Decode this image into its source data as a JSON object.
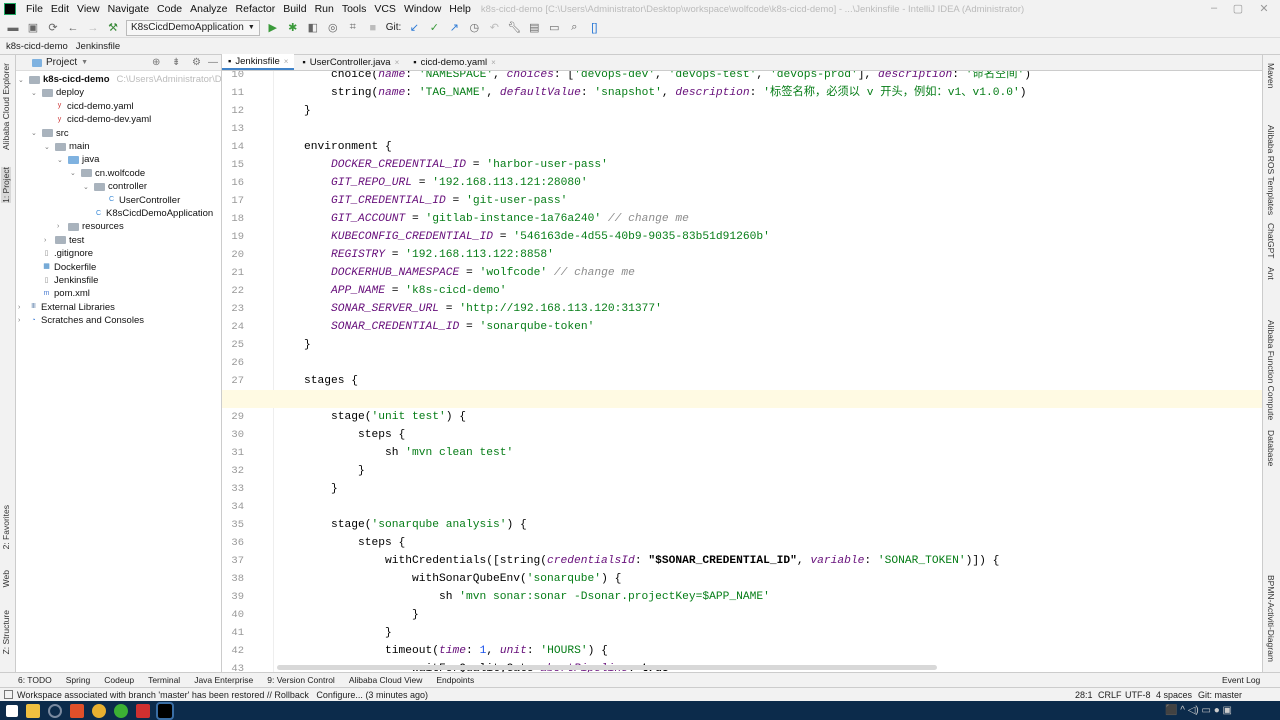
{
  "window": {
    "title": "k8s-cicd-demo [C:\\Users\\Administrator\\Desktop\\workspace\\wolfcode\\k8s-cicd-demo] - ...\\Jenkinsfile - IntelliJ IDEA (Administrator)"
  },
  "menu": [
    "File",
    "Edit",
    "View",
    "Navigate",
    "Code",
    "Analyze",
    "Refactor",
    "Build",
    "Run",
    "Tools",
    "VCS",
    "Window",
    "Help"
  ],
  "toolbar": {
    "run_config": "K8sCicdDemoApplication",
    "git_label": "Git:"
  },
  "navbar": {
    "crumbs": [
      "k8s-cicd-demo",
      "Jenkinsfile"
    ]
  },
  "left_strip": [
    "Alibaba Cloud Explorer",
    "1: Project",
    "2: Favorites",
    "Web",
    "Z: Structure"
  ],
  "right_strip": [
    "Maven",
    "Alibaba ROS Templates",
    "ChatGPT",
    "Ant",
    "Alibaba Function Compute",
    "Database",
    "BPMN-Activiti-Diagram"
  ],
  "project": {
    "header": "Project",
    "tree": [
      {
        "label": "k8s-cicd-demo",
        "hint": "C:\\Users\\Administrator\\Deskto",
        "depth": 0,
        "arrow": "v",
        "icon": "folder",
        "bold": true
      },
      {
        "label": "deploy",
        "depth": 1,
        "arrow": "v",
        "icon": "folder"
      },
      {
        "label": "cicd-demo.yaml",
        "depth": 2,
        "arrow": "",
        "icon": "yaml"
      },
      {
        "label": "cicd-demo-dev.yaml",
        "depth": 2,
        "arrow": "",
        "icon": "yaml"
      },
      {
        "label": "src",
        "depth": 1,
        "arrow": "v",
        "icon": "folder"
      },
      {
        "label": "main",
        "depth": 2,
        "arrow": "v",
        "icon": "folder"
      },
      {
        "label": "java",
        "depth": 3,
        "arrow": "v",
        "icon": "folder-blue"
      },
      {
        "label": "cn.wolfcode",
        "depth": 4,
        "arrow": "v",
        "icon": "folder"
      },
      {
        "label": "controller",
        "depth": 5,
        "arrow": "v",
        "icon": "folder"
      },
      {
        "label": "UserController",
        "depth": 6,
        "arrow": "",
        "icon": "class"
      },
      {
        "label": "K8sCicdDemoApplication",
        "depth": 5,
        "arrow": "",
        "icon": "class"
      },
      {
        "label": "resources",
        "depth": 3,
        "arrow": ">",
        "icon": "folder"
      },
      {
        "label": "test",
        "depth": 2,
        "arrow": ">",
        "icon": "folder"
      },
      {
        "label": ".gitignore",
        "depth": 1,
        "arrow": "",
        "icon": "file"
      },
      {
        "label": "Dockerfile",
        "depth": 1,
        "arrow": "",
        "icon": "docker"
      },
      {
        "label": "Jenkinsfile",
        "depth": 1,
        "arrow": "",
        "icon": "file"
      },
      {
        "label": "pom.xml",
        "depth": 1,
        "arrow": "",
        "icon": "maven"
      },
      {
        "label": "External Libraries",
        "depth": 0,
        "arrow": ">",
        "icon": "lib"
      },
      {
        "label": "Scratches and Consoles",
        "depth": 0,
        "arrow": ">",
        "icon": "scratch"
      }
    ]
  },
  "tabs": [
    {
      "label": "Jenkinsfile",
      "active": true
    },
    {
      "label": "UserController.java"
    },
    {
      "label": "cicd-demo.yaml"
    }
  ],
  "editor": {
    "current_line": 28,
    "first_line": 10,
    "lines": [
      [
        [
          "p",
          "        choice("
        ],
        [
          "k",
          "name"
        ],
        [
          "p",
          ": "
        ],
        [
          "s",
          "'NAMESPACE'"
        ],
        [
          "p",
          ", "
        ],
        [
          "k",
          "choices"
        ],
        [
          "p",
          ": ["
        ],
        [
          "s",
          "'devops-dev'"
        ],
        [
          "p",
          ", "
        ],
        [
          "s",
          "'devops-test'"
        ],
        [
          "p",
          ", "
        ],
        [
          "s",
          "'devops-prod'"
        ],
        [
          "p",
          "], "
        ],
        [
          "k",
          "description"
        ],
        [
          "p",
          ": "
        ],
        [
          "s",
          "'命名空间'"
        ],
        [
          "p",
          ")"
        ]
      ],
      [
        [
          "p",
          "        string("
        ],
        [
          "k",
          "name"
        ],
        [
          "p",
          ": "
        ],
        [
          "s",
          "'TAG_NAME'"
        ],
        [
          "p",
          ", "
        ],
        [
          "k",
          "defaultValue"
        ],
        [
          "p",
          ": "
        ],
        [
          "s",
          "'snapshot'"
        ],
        [
          "p",
          ", "
        ],
        [
          "k",
          "description"
        ],
        [
          "p",
          ": "
        ],
        [
          "s",
          "'标签名称，必须以 v 开头，例如：v1、v1.0.0'"
        ],
        [
          "p",
          ")"
        ]
      ],
      [
        [
          "p",
          "    }"
        ]
      ],
      [],
      [
        [
          "p",
          "    environment {"
        ]
      ],
      [
        [
          "p",
          "        "
        ],
        [
          "k",
          "DOCKER_CREDENTIAL_ID"
        ],
        [
          "p",
          " = "
        ],
        [
          "s",
          "'harbor-user-pass'"
        ]
      ],
      [
        [
          "p",
          "        "
        ],
        [
          "k",
          "GIT_REPO_URL"
        ],
        [
          "p",
          " = "
        ],
        [
          "s",
          "'192.168.113.121:28080'"
        ]
      ],
      [
        [
          "p",
          "        "
        ],
        [
          "k",
          "GIT_CREDENTIAL_ID"
        ],
        [
          "p",
          " = "
        ],
        [
          "s",
          "'git-user-pass'"
        ]
      ],
      [
        [
          "p",
          "        "
        ],
        [
          "k",
          "GIT_ACCOUNT"
        ],
        [
          "p",
          " = "
        ],
        [
          "s",
          "'gitlab-instance-1a76a240'"
        ],
        [
          "p",
          " "
        ],
        [
          "c",
          "// change me"
        ]
      ],
      [
        [
          "p",
          "        "
        ],
        [
          "k",
          "KUBECONFIG_CREDENTIAL_ID"
        ],
        [
          "p",
          " = "
        ],
        [
          "s",
          "'546163de-4d55-40b9-9035-83b51d91260b'"
        ]
      ],
      [
        [
          "p",
          "        "
        ],
        [
          "k",
          "REGISTRY"
        ],
        [
          "p",
          " = "
        ],
        [
          "s",
          "'192.168.113.122:8858'"
        ]
      ],
      [
        [
          "p",
          "        "
        ],
        [
          "k",
          "DOCKERHUB_NAMESPACE"
        ],
        [
          "p",
          " = "
        ],
        [
          "s",
          "'wolfcode'"
        ],
        [
          "p",
          " "
        ],
        [
          "c",
          "// change me"
        ]
      ],
      [
        [
          "p",
          "        "
        ],
        [
          "k",
          "APP_NAME"
        ],
        [
          "p",
          " = "
        ],
        [
          "s",
          "'k8s-cicd-demo'"
        ]
      ],
      [
        [
          "p",
          "        "
        ],
        [
          "k",
          "SONAR_SERVER_URL"
        ],
        [
          "p",
          " = "
        ],
        [
          "s",
          "'http://192.168.113.120:31377'"
        ]
      ],
      [
        [
          "p",
          "        "
        ],
        [
          "k",
          "SONAR_CREDENTIAL_ID"
        ],
        [
          "p",
          " = "
        ],
        [
          "s",
          "'sonarqube-token'"
        ]
      ],
      [
        [
          "p",
          "    }"
        ]
      ],
      [],
      [
        [
          "p",
          "    stages {"
        ]
      ],
      [],
      [
        [
          "p",
          "        stage("
        ],
        [
          "s",
          "'unit test'"
        ],
        [
          "p",
          ") {"
        ]
      ],
      [
        [
          "p",
          "            steps {"
        ]
      ],
      [
        [
          "p",
          "                sh "
        ],
        [
          "s",
          "'mvn clean test'"
        ]
      ],
      [
        [
          "p",
          "            }"
        ]
      ],
      [
        [
          "p",
          "        }"
        ]
      ],
      [],
      [
        [
          "p",
          "        stage("
        ],
        [
          "s",
          "'sonarqube analysis'"
        ],
        [
          "p",
          ") {"
        ]
      ],
      [
        [
          "p",
          "            steps {"
        ]
      ],
      [
        [
          "p",
          "                withCredentials([string("
        ],
        [
          "k",
          "credentialsId"
        ],
        [
          "p",
          ": "
        ],
        [
          "b",
          "\"$SONAR_CREDENTIAL_ID\""
        ],
        [
          "p",
          ", "
        ],
        [
          "k",
          "variable"
        ],
        [
          "p",
          ": "
        ],
        [
          "s",
          "'SONAR_TOKEN'"
        ],
        [
          "p",
          ")]) {"
        ]
      ],
      [
        [
          "p",
          "                    withSonarQubeEnv("
        ],
        [
          "s",
          "'sonarqube'"
        ],
        [
          "p",
          ") {"
        ]
      ],
      [
        [
          "p",
          "                        sh "
        ],
        [
          "s",
          "'mvn sonar:sonar -Dsonar.projectKey=$APP_NAME'"
        ]
      ],
      [
        [
          "p",
          "                    }"
        ]
      ],
      [
        [
          "p",
          "                }"
        ]
      ],
      [
        [
          "p",
          "                timeout("
        ],
        [
          "k",
          "time"
        ],
        [
          "p",
          ": "
        ],
        [
          "n",
          "1"
        ],
        [
          "p",
          ", "
        ],
        [
          "k",
          "unit"
        ],
        [
          "p",
          ": "
        ],
        [
          "s",
          "'HOURS'"
        ],
        [
          "p",
          ") {"
        ]
      ],
      [
        [
          "p",
          "                    waitForQualityGate "
        ],
        [
          "k",
          "abortPipeline"
        ],
        [
          "p",
          ": "
        ],
        [
          "b",
          "true"
        ]
      ]
    ]
  },
  "bottom_tabs": [
    "6: TODO",
    "Spring",
    "Codeup",
    "Terminal",
    "Java Enterprise",
    "9: Version Control",
    "Alibaba Cloud View",
    "Endpoints"
  ],
  "event_log": "Event Log",
  "status": {
    "message": "Workspace associated with branch 'master' has been restored // Rollback   Configure... (3 minutes ago)",
    "position": "28:1",
    "line_sep": "CRLF",
    "encoding": "UTF-8",
    "indent": "4 spaces",
    "git": "Git: master"
  },
  "colors": {
    "accent": "#4083c9",
    "taskbar": "#0c2b4b",
    "current_line": "#fffae3"
  }
}
